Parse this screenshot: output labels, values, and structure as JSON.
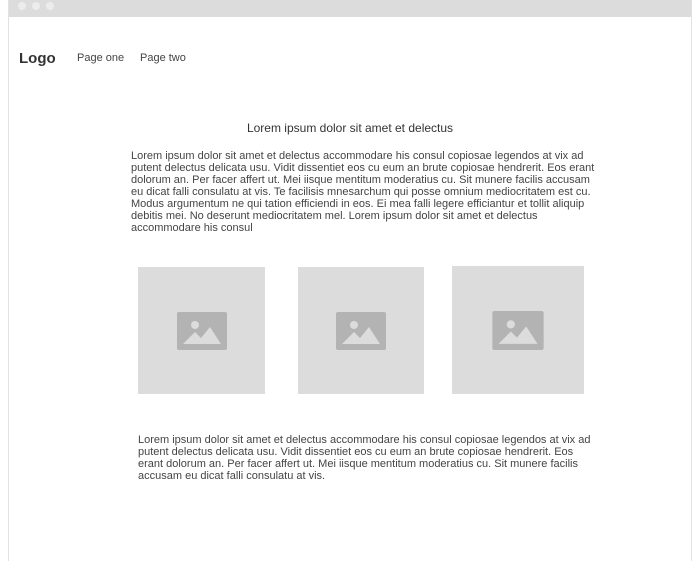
{
  "nav": {
    "logo": "Logo",
    "links": [
      "Page one",
      "Page two"
    ]
  },
  "content": {
    "heading": "Lorem ipsum dolor sit amet et delectus",
    "paragraph1": "Lorem ipsum dolor sit amet et delectus accommodare his consul copiosae legendos at vix ad putent delectus delicata usu. Vidit dissentiet eos cu eum an brute copiosae hendrerit. Eos erant dolorum an. Per facer affert ut. Mei iisque mentitum moderatius cu. Sit munere facilis accusam eu dicat falli consulatu at vis. Te facilisis mnesarchum qui posse omnium mediocritatem est cu. Modus argumentum ne qui tation efficiendi in eos. Ei mea falli legere efficiantur et tollit aliquip debitis mei. No deserunt mediocritatem mel. Lorem ipsum dolor sit amet et delectus accommodare his consul",
    "paragraph2": "Lorem ipsum dolor sit amet et delectus accommodare his consul copiosae legendos at vix ad putent delectus delicata usu. Vidit dissentiet eos cu eum an brute copiosae hendrerit. Eos erant dolorum an. Per facer affert ut. Mei iisque mentitum moderatius cu. Sit munere facilis accusam eu dicat falli consulatu at vis.",
    "images": [
      "image-icon",
      "image-icon",
      "image-icon"
    ]
  },
  "colors": {
    "placeholder_bg": "#dcdcdc",
    "icon_fill": "#b3b3b3",
    "titlebar": "#dcdcdc"
  }
}
